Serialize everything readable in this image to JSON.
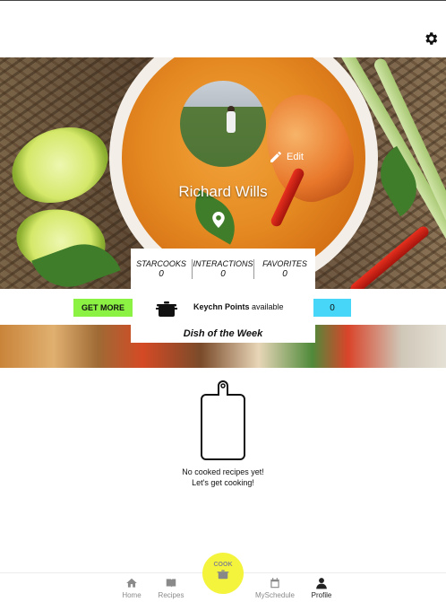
{
  "profile": {
    "name": "Richard Wills",
    "edit_label": "Edit"
  },
  "stats": [
    {
      "label": "STARCOOKS",
      "value": "0"
    },
    {
      "label": "INTERACTIONS",
      "value": "0"
    },
    {
      "label": "FAVORITES",
      "value": "0"
    }
  ],
  "points": {
    "get_more_label": "GET MORE",
    "title": "Keychn Points",
    "suffix": "available",
    "value": "0"
  },
  "dish_of_week": "Dish of the Week",
  "empty_state": {
    "line1": "No cooked recipes yet!",
    "line2": "Let's get cooking!"
  },
  "tabbar": {
    "home": "Home",
    "recipes": "Recipes",
    "cook": "COOK",
    "myschedule": "MySchedule",
    "profile": "Profile"
  },
  "icons": {
    "settings": "gear-icon",
    "edit": "pencil-icon",
    "location": "location-pin-icon",
    "points": "cooking-pot-icon",
    "empty": "cutting-board-icon",
    "home": "home-icon",
    "recipes": "book-icon",
    "cook": "cooking-pot-icon",
    "myschedule": "calendar-icon",
    "profile": "person-icon"
  },
  "colors": {
    "get_more_bg": "#8bf244",
    "points_bg": "#47d6f7",
    "cook_button_bg": "#f4f43c"
  }
}
